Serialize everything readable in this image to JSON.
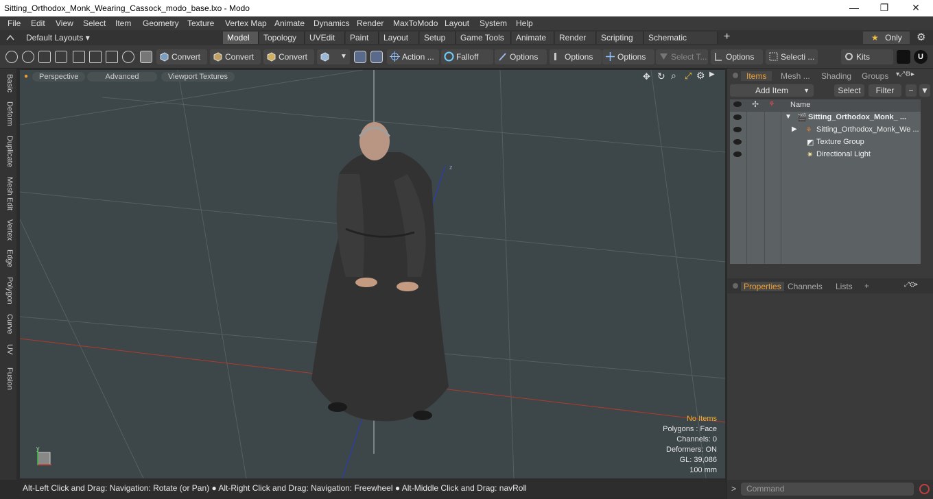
{
  "window": {
    "title": "Sitting_Orthodox_Monk_Wearing_Cassock_modo_base.lxo - Modo",
    "minimize": "—",
    "maximize": "❐",
    "close": "✕"
  },
  "menu": [
    "File",
    "Edit",
    "View",
    "Select",
    "Item",
    "Geometry",
    "Texture",
    "Vertex Map",
    "Animate",
    "Dynamics",
    "Render",
    "MaxToModo",
    "Layout",
    "System",
    "Help"
  ],
  "layouts_label": "Default Layouts ▾",
  "tabs": [
    "Model",
    "Topology",
    "UVEdit",
    "Paint",
    "Layout",
    "Setup",
    "Game Tools",
    "Animate",
    "Render",
    "Scripting",
    "Schematic Fusion"
  ],
  "tabs_add": "+",
  "only_label": "Only",
  "toolbar": {
    "convert1": "Convert",
    "convert2": "Convert",
    "convert3": "Convert",
    "action": "Action",
    "falloff": "Falloff",
    "options1": "Options",
    "options2": "Options",
    "options3": "Options",
    "select_t": "Select T...",
    "options4": "Options",
    "selecti": "Selecti ...",
    "kits": "Kits"
  },
  "left_tabs": [
    "Basic",
    "Deform",
    "Duplicate",
    "Mesh Edit",
    "Vertex",
    "Edge",
    "Polygon",
    "Curve",
    "UV",
    "Fusion"
  ],
  "viewport": {
    "tab_perspective": "Perspective",
    "tab_advanced": "Advanced",
    "tab_textures": "Viewport Textures",
    "no_items": "No Items",
    "polygons": "Polygons : Face",
    "channels": "Channels: 0",
    "deformers": "Deformers: ON",
    "gl": "GL: 39,086",
    "scale": "100 mm",
    "axis_y": "y"
  },
  "status": "Alt-Left Click and Drag: Navigation: Rotate (or Pan) ● Alt-Right Click and Drag: Navigation: Freewheel ● Alt-Middle Click and Drag: navRoll",
  "items_panel": {
    "tabs": [
      "Items",
      "Mesh ...",
      "Shading",
      "Groups"
    ],
    "add_item": "Add Item",
    "select": "Select",
    "filter": "Filter",
    "col_name": "Name",
    "rows": [
      {
        "label": "Sitting_Orthodox_Monk_ ..."
      },
      {
        "label": "Sitting_Orthodox_Monk_We ..."
      },
      {
        "label": "Texture Group"
      },
      {
        "label": "Directional Light"
      }
    ]
  },
  "props_panel": {
    "tabs": [
      "Properties",
      "Channels",
      "Lists"
    ],
    "add": "+"
  },
  "command_placeholder": "Command",
  "colors": {
    "active_tab": "#f0a030",
    "viewport_bg": "#3d4649",
    "x_axis": "#c0392b",
    "z_axis": "#2a3eb0"
  }
}
